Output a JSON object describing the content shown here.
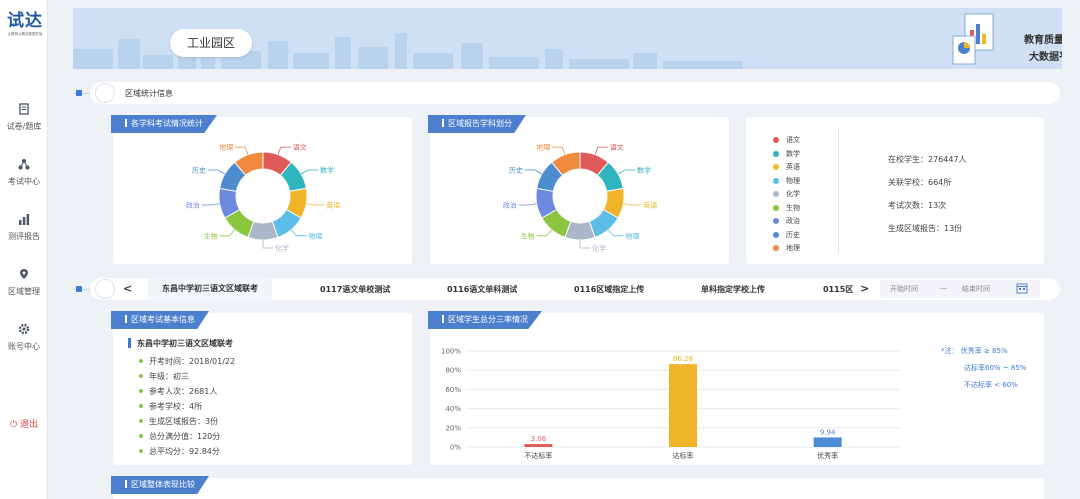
{
  "sidebar": {
    "logo": "试达",
    "logo_sub": "让教育从看见数据开始",
    "items": [
      {
        "label": "试卷/题库",
        "icon": "document-icon"
      },
      {
        "label": "考试中心",
        "icon": "org-chart-icon"
      },
      {
        "label": "测评报告",
        "icon": "bar-chart-icon"
      },
      {
        "label": "区域管理",
        "icon": "location-icon"
      },
      {
        "label": "账号中心",
        "icon": "gear-icon"
      }
    ],
    "logout": "退出"
  },
  "banner": {
    "region": "工业园区",
    "title_line1": "教育质量检测",
    "title_line2": "大数据平台"
  },
  "section1": {
    "title": "区域统计信息"
  },
  "card_subject_exam": {
    "tag": "各学科考试情况统计",
    "chart_data": {
      "type": "pie",
      "categories": [
        "语文",
        "数学",
        "英语",
        "物理",
        "化学",
        "生物",
        "政治",
        "历史",
        "地理"
      ],
      "values": [
        1,
        1,
        1,
        1,
        1,
        1,
        1,
        1,
        1
      ],
      "colors": [
        "#e05a5a",
        "#2fb5bd",
        "#f0b429",
        "#5bbde8",
        "#a9b7c8",
        "#8cc63f",
        "#6d8ae0",
        "#4c8ccf",
        "#f08a3c"
      ]
    }
  },
  "card_subject_report": {
    "tag": "区域报告学科划分",
    "chart_data": {
      "type": "pie",
      "categories": [
        "语文",
        "数学",
        "英语",
        "物理",
        "化学",
        "生物",
        "政治",
        "历史",
        "地理"
      ],
      "values": [
        1,
        1,
        1,
        1,
        1,
        1,
        1,
        1,
        1
      ],
      "colors": [
        "#e05a5a",
        "#2fb5bd",
        "#f0b429",
        "#5bbde8",
        "#a9b7c8",
        "#8cc63f",
        "#6d8ae0",
        "#4c8ccf",
        "#f08a3c"
      ]
    }
  },
  "card_stats": {
    "legend": [
      {
        "label": "语文",
        "color": "#e05a5a"
      },
      {
        "label": "数学",
        "color": "#2fb5bd"
      },
      {
        "label": "英语",
        "color": "#f0b429"
      },
      {
        "label": "物理",
        "color": "#5bbde8"
      },
      {
        "label": "化学",
        "color": "#a9b7c8"
      },
      {
        "label": "生物",
        "color": "#8cc63f"
      },
      {
        "label": "政治",
        "color": "#6d8ae0"
      },
      {
        "label": "历史",
        "color": "#4c8ccf"
      },
      {
        "label": "地理",
        "color": "#f08a3c"
      }
    ],
    "stats": [
      "在校学生：276447人",
      "关联学校：664所",
      "考试次数：13次",
      "生成区域报告：13份"
    ]
  },
  "exam_tabs": {
    "prev": "<",
    "next": ">",
    "items": [
      "东昌中学初三语文区域联考",
      "0117语文单校测试",
      "0116语文单科测试",
      "0116区域指定上传",
      "单科指定学校上传",
      "0115区"
    ],
    "start_placeholder": "开始时间",
    "dash": "—",
    "end_placeholder": "结束时间"
  },
  "card_basic": {
    "tag": "区域考试基本信息",
    "title": "东昌中学初三语文区域联考",
    "items": [
      "开考时间：2018/01/22",
      "年级：初三",
      "参考人次：2681人",
      "参考学校：4所",
      "生成区域报告：3份",
      "总分满分值：120分",
      "总平均分：92.84分"
    ]
  },
  "card_rates": {
    "tag": "区域学生总分三率情况",
    "chart_data": {
      "type": "bar",
      "categories": [
        "不达标率",
        "达标率",
        "优秀率"
      ],
      "values": [
        3.06,
        86.28,
        9.94
      ],
      "value_labels": [
        "3.06",
        "86.28",
        "9.94"
      ],
      "colors": [
        "#e05a5a",
        "#f0b429",
        "#4d8ad8"
      ],
      "ylim": [
        0,
        100
      ],
      "yticks": [
        "0%",
        "20%",
        "40%",
        "60%",
        "80%",
        "100%"
      ]
    },
    "notes": [
      "*注：  优秀率 ≥ 85%",
      "达标率60% ~ 85%",
      "不达标率 < 60%"
    ]
  },
  "card_overall": {
    "tag": "区域整体表现比较"
  }
}
